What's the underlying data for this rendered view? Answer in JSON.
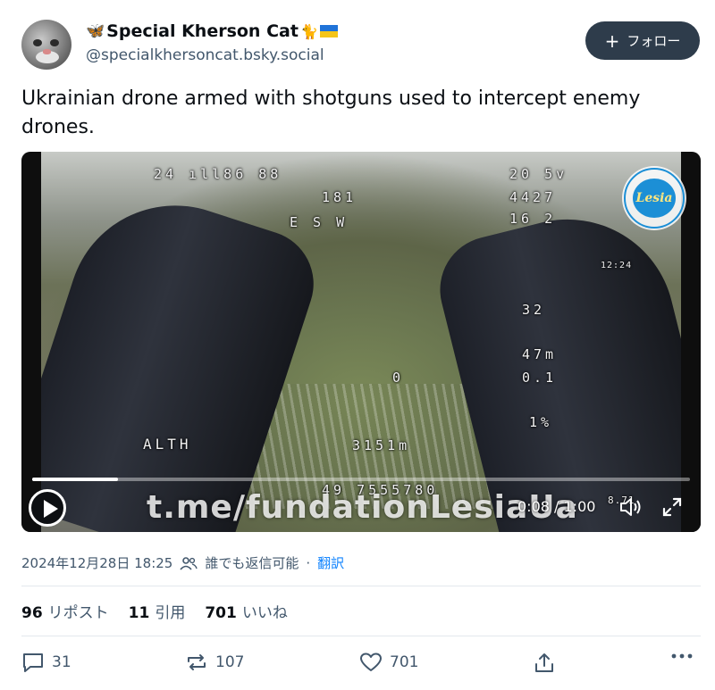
{
  "author": {
    "display_name": "Special Kherson Cat",
    "handle": "@specialkhersoncat.bsky.social",
    "avatar_icon": "cat-avatar"
  },
  "follow_button": {
    "label": "フォロー",
    "icon": "plus-icon"
  },
  "post": {
    "text": "Ukrainian drone armed with shotguns used to intercept enemy drones."
  },
  "video": {
    "watermark": "t.me/fundationLesiaUa",
    "time_display": "0:08 / 1:00",
    "progress": 0.13,
    "logo_text": "Lesia",
    "osd": {
      "top_left": "24 ıll86 88",
      "heading": "181",
      "compass": "E    S    W",
      "top_right_1": "20 5v",
      "top_right_2": "4427",
      "top_right_3": "16 2",
      "right_mid_1": "32",
      "right_mid_2": "47m",
      "right_mid_3": "0.1",
      "center": "0",
      "percent": "1%",
      "alt_label": "ALTH",
      "distance": "3151m",
      "bottom": "49 7555780",
      "side_time": "12:24",
      "bottom_right": "8.71"
    }
  },
  "meta": {
    "timestamp": "2024年12月28日 18:25",
    "audience": "誰でも返信可能",
    "separator": "·",
    "translate": "翻訳"
  },
  "counts": {
    "reposts_num": "96",
    "reposts_label": "リポスト",
    "quotes_num": "11",
    "quotes_label": "引用",
    "likes_num": "701",
    "likes_label": "いいね"
  },
  "actions": {
    "reply_count": "31",
    "repost_count": "107",
    "like_count": "701"
  },
  "colors": {
    "accent": "#1083fe",
    "follow_bg": "#2e3c4b",
    "muted_text": "#42576c"
  }
}
